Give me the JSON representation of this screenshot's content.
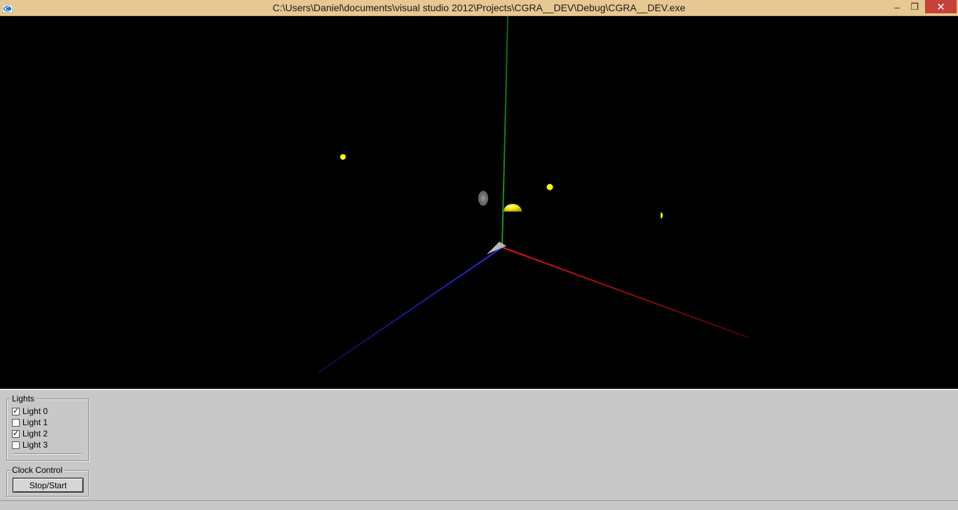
{
  "window": {
    "title": "C:\\Users\\Daniel\\documents\\visual studio 2012\\Projects\\CGRA__DEV\\Debug\\CGRA__DEV.exe",
    "app_icon": "glut-app-icon",
    "controls": {
      "minimize": "–",
      "maximize": "❐",
      "close": "✕"
    }
  },
  "colors": {
    "titlebar": "#e7c792",
    "close_button": "#c7413a",
    "axis_x": "#e8141e",
    "axis_y": "#1f9a1f",
    "axis_z": "#2222dd",
    "light_source": "#ffff00",
    "panel": "#c8c8c8"
  },
  "scene": {
    "objects": [
      "x-axis",
      "y-axis",
      "z-axis",
      "light-sphere",
      "light-sphere",
      "light-sphere",
      "yellow-hemisphere",
      "gray-disc",
      "origin-marker"
    ]
  },
  "lights_panel": {
    "label": "Lights",
    "items": [
      {
        "label": "Light 0",
        "checked": true
      },
      {
        "label": "Light 1",
        "checked": false
      },
      {
        "label": "Light 2",
        "checked": true
      },
      {
        "label": "Light 3",
        "checked": false
      }
    ]
  },
  "clock_panel": {
    "label": "Clock Control",
    "button_label": "Stop/Start"
  }
}
